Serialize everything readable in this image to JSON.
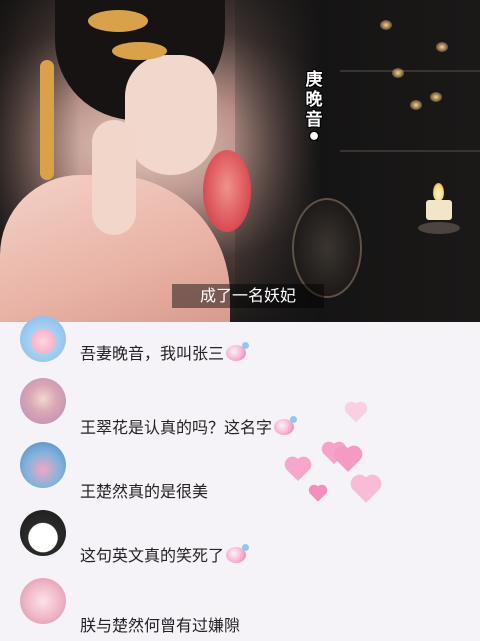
{
  "video": {
    "title_overlay": "庚\n晚\n音",
    "subtitle": "成了一名妖妃"
  },
  "comments": [
    {
      "text": "吾妻晚音，我叫张三",
      "emoji": "shy-face-emoji"
    },
    {
      "text": "王翠花是认真的吗？这名字",
      "emoji": "shy-face-emoji"
    },
    {
      "text": "王楚然真的是很美",
      "emoji": ""
    },
    {
      "text": "这句英文真的笑死了",
      "emoji": "shy-face-emoji"
    },
    {
      "text": "朕与楚然何曾有过嫌隙",
      "emoji": ""
    }
  ],
  "colors": {
    "heart": "#f59bc3",
    "background": "#f5f3f7"
  }
}
